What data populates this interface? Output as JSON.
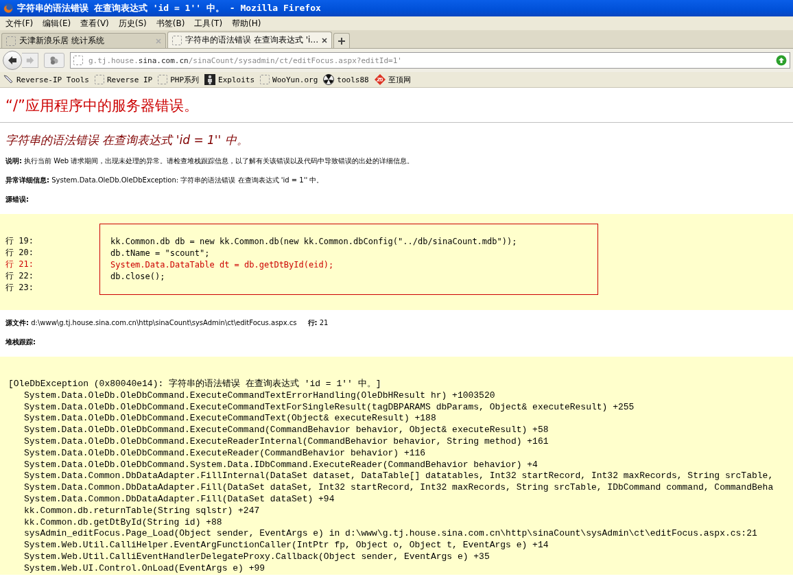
{
  "window": {
    "title": "字符串的语法错误 在查询表达式 'id = 1'' 中。 - Mozilla Firefox"
  },
  "menu": [
    "文件(F)",
    "编辑(E)",
    "查看(V)",
    "历史(S)",
    "书签(B)",
    "工具(T)",
    "帮助(H)"
  ],
  "tabs": [
    {
      "label": "天津新浪乐居 统计系统",
      "selected": false
    },
    {
      "label": "字符串的语法错误 在查询表达式 'i…",
      "selected": true
    }
  ],
  "address": {
    "url_start": "g.tj.house.",
    "url_domain": "sina.com.cn",
    "url_path": "/sinaCount/sysadmin/ct/editFocus.aspx?editId=1'"
  },
  "bookmarks": [
    {
      "label": "Reverse-IP Tools",
      "kind": "pen"
    },
    {
      "label": "Reverse IP",
      "kind": "blank"
    },
    {
      "label": "PHP系列",
      "kind": "blank"
    },
    {
      "label": "Exploits",
      "kind": "figure"
    },
    {
      "label": "WooYun.org",
      "kind": "blank"
    },
    {
      "label": "tools88",
      "kind": "radiation"
    },
    {
      "label": "至顶网",
      "kind": "zd"
    }
  ],
  "page": {
    "heading": "“/”应用程序中的服务器错误。",
    "error_title": "字符串的语法错误 在查询表达式 'id = 1'' 中。",
    "description": {
      "label": "说明:",
      "text": "执行当前 Web 请求期间，出现未处理的异常。请检查堆栈跟踪信息，以了解有关该错误以及代码中导致错误的出处的详细信息。"
    },
    "exception_details": {
      "label": "异常详细信息:",
      "text": "System.Data.OleDb.OleDbException: 字符串的语法错误 在查询表达式 'id = 1'' 中。"
    },
    "source_error": {
      "label": "源错误:"
    },
    "source_lines": [
      {
        "line": "行 19:",
        "code": "kk.Common.db db = new kk.Common.db(new kk.Common.dbConfig(\"../db/sinaCount.mdb\"));",
        "highlighted": false
      },
      {
        "line": "行 20:",
        "code": "db.tName = \"scount\";",
        "highlighted": false
      },
      {
        "line": "行 21:",
        "code": "System.Data.DataTable dt = db.getDtById(eid);",
        "highlighted": true
      },
      {
        "line": "行 22:",
        "code": "db.close();",
        "highlighted": false
      },
      {
        "line": "行 23:",
        "highlighted": false
      }
    ],
    "source_file": {
      "label": "源文件:",
      "value": "d:\\www\\g.tj.house.sina.com.cn\\http\\sinaCount\\sysAdmin\\ct\\editFocus.aspx.cs",
      "line_label": "行:",
      "line_value": "21"
    },
    "stack_trace": {
      "label": "堆栈跟踪:",
      "header": "[OleDbException (0x80040e14): 字符串的语法错误 在查询表达式 'id = 1'' 中。]",
      "lines": [
        "System.Data.OleDb.OleDbCommand.ExecuteCommandTextErrorHandling(OleDbHResult hr) +1003520",
        "System.Data.OleDb.OleDbCommand.ExecuteCommandTextForSingleResult(tagDBPARAMS dbParams, Object& executeResult) +255",
        "System.Data.OleDb.OleDbCommand.ExecuteCommandText(Object& executeResult) +188",
        "System.Data.OleDb.OleDbCommand.ExecuteCommand(CommandBehavior behavior, Object& executeResult) +58",
        "System.Data.OleDb.OleDbCommand.ExecuteReaderInternal(CommandBehavior behavior, String method) +161",
        "System.Data.OleDb.OleDbCommand.ExecuteReader(CommandBehavior behavior) +116",
        "System.Data.OleDb.OleDbCommand.System.Data.IDbCommand.ExecuteReader(CommandBehavior behavior) +4",
        "System.Data.Common.DbDataAdapter.FillInternal(DataSet dataset, DataTable[] datatables, Int32 startRecord, Int32 maxRecords, String srcTable,",
        "System.Data.Common.DbDataAdapter.Fill(DataSet dataSet, Int32 startRecord, Int32 maxRecords, String srcTable, IDbCommand command, CommandBeha",
        "System.Data.Common.DbDataAdapter.Fill(DataSet dataSet) +94",
        "kk.Common.db.returnTable(String sqlstr) +247",
        "kk.Common.db.getDtById(String id) +88",
        "sysAdmin_editFocus.Page_Load(Object sender, EventArgs e) in d:\\www\\g.tj.house.sina.com.cn\\http\\sinaCount\\sysAdmin\\ct\\editFocus.aspx.cs:21",
        "System.Web.Util.CalliHelper.EventArgFunctionCaller(IntPtr fp, Object o, Object t, EventArgs e) +14",
        "System.Web.Util.CalliEventHandlerDelegateProxy.Callback(Object sender, EventArgs e) +35",
        "System.Web.UI.Control.OnLoad(EventArgs e) +99"
      ]
    }
  }
}
